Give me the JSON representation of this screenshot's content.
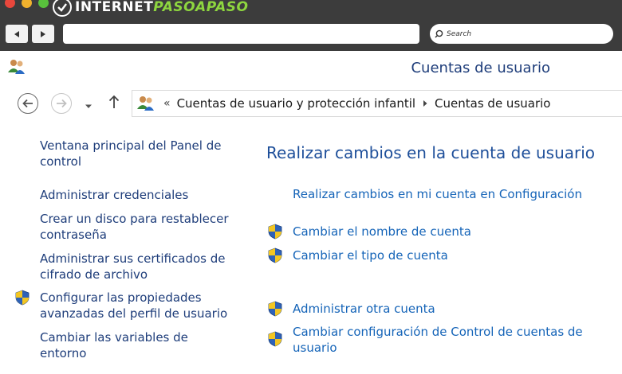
{
  "browser": {
    "logo": {
      "part1": "INTERNET",
      "part2": "PASOAPASO"
    },
    "search_placeholder": "Search",
    "url_value": ""
  },
  "window": {
    "title": "Cuentas de usuario"
  },
  "address": {
    "overflow": "«",
    "crumbs": [
      "Cuentas de usuario y protección infantil",
      "Cuentas de usuario"
    ]
  },
  "sidebar": {
    "items": [
      {
        "label": "Ventana principal del Panel de control",
        "shield": false
      },
      {
        "label": "Administrar credenciales",
        "shield": false
      },
      {
        "label": "Crear un disco para restablecer contraseña",
        "shield": false
      },
      {
        "label": "Administrar sus certificados de cifrado de archivo",
        "shield": false
      },
      {
        "label": "Configurar las propiedades avanzadas del perfil de usuario",
        "shield": true
      },
      {
        "label": "Cambiar las variables de entorno",
        "shield": false
      }
    ]
  },
  "main": {
    "title": "Realizar cambios en la cuenta de usuario",
    "links": [
      {
        "label": "Realizar cambios en mi cuenta en Configuración",
        "shield": false
      },
      {
        "label": "Cambiar el nombre de cuenta",
        "shield": true
      },
      {
        "label": "Cambiar el tipo de cuenta",
        "shield": true
      },
      {
        "label": "Administrar otra cuenta",
        "shield": true
      },
      {
        "label": "Cambiar configuración de Control de cuentas de usuario",
        "shield": true
      }
    ]
  },
  "colors": {
    "link": "#1564b8",
    "heading": "#1e4f9a",
    "sidebar_link": "#1e3d7a",
    "browser_chrome": "#3c3c3c"
  },
  "icons": {
    "shield": "uac-shield-icon",
    "users": "user-accounts-icon"
  }
}
